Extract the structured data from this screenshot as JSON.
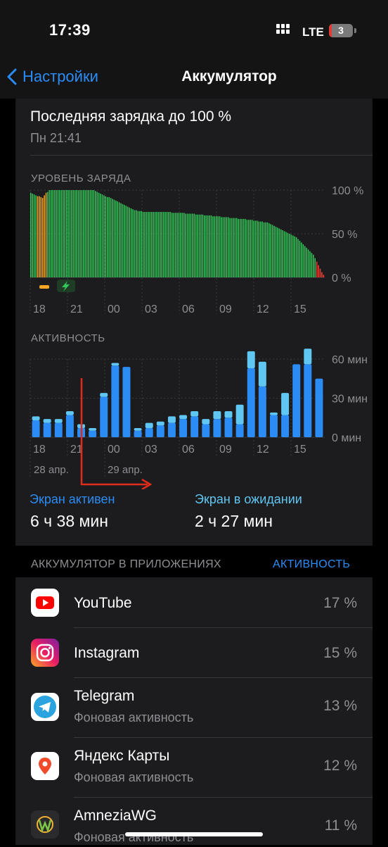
{
  "status_bar": {
    "time": "17:39",
    "network": "LTE",
    "battery_level": "3"
  },
  "nav": {
    "back_label": "Настройки",
    "title": "Аккумулятор"
  },
  "last_charge": {
    "title": "Последняя зарядка до 100 %",
    "time": "Пн 21:41"
  },
  "colors": {
    "accent": "#2b8cf5",
    "screen_on": "#2b8cf5",
    "screen_off": "#5fc7f2",
    "battery_ok": "#34c759",
    "battery_charging": "#f5a623",
    "battery_low": "#ff3b30"
  },
  "chart_data": [
    {
      "type": "bar",
      "title": "УРОВЕНЬ ЗАРЯДА",
      "x_tick_labels": [
        "18",
        "21",
        "00",
        "03",
        "06",
        "09",
        "12",
        "15"
      ],
      "y_tick_labels": [
        "100 %",
        "50 %",
        "0 %"
      ],
      "ylim": [
        0,
        100
      ],
      "units": "%",
      "charging_indicator_icon": "bolt-icon",
      "values": [
        97,
        96,
        95,
        94,
        93,
        93,
        92,
        91,
        94,
        97,
        98,
        100,
        100,
        100,
        100,
        100,
        100,
        100,
        100,
        100,
        100,
        100,
        100,
        100,
        100,
        100,
        100,
        100,
        100,
        100,
        100,
        100,
        100,
        100,
        100,
        100,
        100,
        100,
        99,
        98,
        97,
        96,
        95,
        94,
        93,
        92,
        92,
        91,
        90,
        89,
        88,
        87,
        86,
        85,
        84,
        83,
        82,
        81,
        80,
        79,
        78,
        77,
        77,
        76,
        76,
        76,
        75,
        75,
        75,
        75,
        75,
        75,
        75,
        75,
        75,
        75,
        75,
        75,
        75,
        75,
        75,
        75,
        75,
        74,
        74,
        74,
        74,
        74,
        74,
        74,
        74,
        73,
        73,
        73,
        73,
        73,
        73,
        72,
        72,
        72,
        72,
        72,
        71,
        71,
        71,
        71,
        71,
        70,
        70,
        70,
        70,
        70,
        69,
        69,
        69,
        69,
        69,
        68,
        68,
        68,
        68,
        68,
        67,
        67,
        67,
        67,
        67,
        66,
        66,
        66,
        66,
        65,
        65,
        65,
        64,
        64,
        64,
        63,
        63,
        63,
        62,
        61,
        60,
        59,
        58,
        57,
        56,
        55,
        54,
        53,
        52,
        51,
        50,
        49,
        48,
        47,
        46,
        44,
        42,
        40,
        38,
        36,
        34,
        32,
        30,
        28,
        26,
        22,
        18,
        14,
        10,
        6,
        3
      ],
      "charging_bar_range": [
        4,
        9
      ],
      "low_threshold": 20
    },
    {
      "type": "bar",
      "title": "АКТИВНОСТЬ",
      "x_tick_labels": [
        "18",
        "21",
        "00",
        "03",
        "06",
        "09",
        "12",
        "15"
      ],
      "date_labels": [
        "28 апр.",
        "29 апр."
      ],
      "y_tick_labels": [
        "60 мин",
        "30 мин",
        "0 мин"
      ],
      "ylim": [
        0,
        60
      ],
      "units": "мин",
      "series": [
        {
          "name": "Экран активен",
          "values": [
            13,
            11,
            11,
            17,
            7,
            5,
            31,
            55,
            54,
            5,
            7,
            9,
            11,
            14,
            16,
            10,
            14,
            15,
            10,
            53,
            39,
            17,
            17,
            56,
            56,
            45
          ]
        },
        {
          "name": "Экран в ожидании",
          "values": [
            3,
            3,
            3,
            3,
            3,
            2,
            3,
            2,
            0,
            2,
            4,
            3,
            5,
            3,
            4,
            4,
            6,
            5,
            15,
            13,
            19,
            2,
            17,
            0,
            12,
            0
          ]
        }
      ]
    }
  ],
  "activity": {
    "screen_on_label": "Экран активен",
    "screen_on_value": "6 ч 38 мин",
    "screen_off_label": "Экран в ожидании",
    "screen_off_value": "2 ч 27 мин"
  },
  "apps_section": {
    "header": "АККУМУЛЯТОР В ПРИЛОЖЕНИЯХ",
    "mode_button": "АКТИВНОСТЬ",
    "items": [
      {
        "name": "YouTube",
        "subtitle": "",
        "percent": "17 %",
        "icon": "youtube-icon"
      },
      {
        "name": "Instagram",
        "subtitle": "",
        "percent": "15 %",
        "icon": "instagram-icon"
      },
      {
        "name": "Telegram",
        "subtitle": "Фоновая активность",
        "percent": "13 %",
        "icon": "telegram-icon"
      },
      {
        "name": "Яндекс Карты",
        "subtitle": "Фоновая активность",
        "percent": "12 %",
        "icon": "yandex-maps-icon"
      },
      {
        "name": "AmneziaWG",
        "subtitle": "Фоновая активность",
        "percent": "11 %",
        "icon": "amneziawg-icon"
      }
    ]
  }
}
